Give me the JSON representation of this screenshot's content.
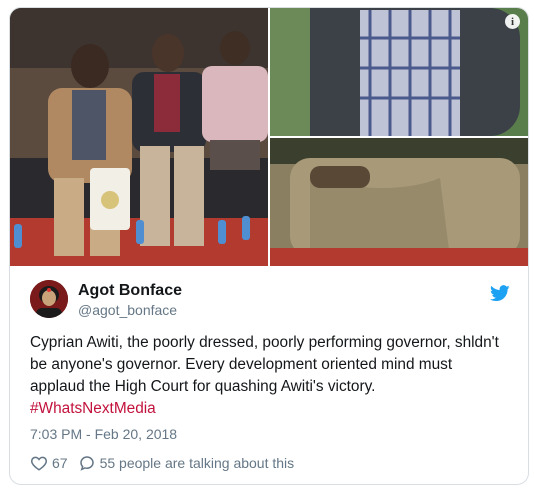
{
  "media": {
    "info_icon": "info-icon"
  },
  "author": {
    "display_name": "Agot Bonface",
    "handle": "@agot_bonface",
    "logo": "twitter-bird-icon"
  },
  "tweet": {
    "text": "Cyprian Awiti, the poorly dressed, poorly performing governor, shldn't be anyone's governor. Every development oriented mind must applaud the High Court for quashing Awiti's victory.",
    "hashtag": "#WhatsNextMedia",
    "timestamp": "7:03 PM - Feb 20, 2018"
  },
  "actions": {
    "like_count": "67",
    "reply_text": "55 people are talking about this"
  },
  "colors": {
    "hashtag": "#c2123c",
    "twitter_blue": "#1da1f2",
    "secondary_text": "#657786"
  }
}
